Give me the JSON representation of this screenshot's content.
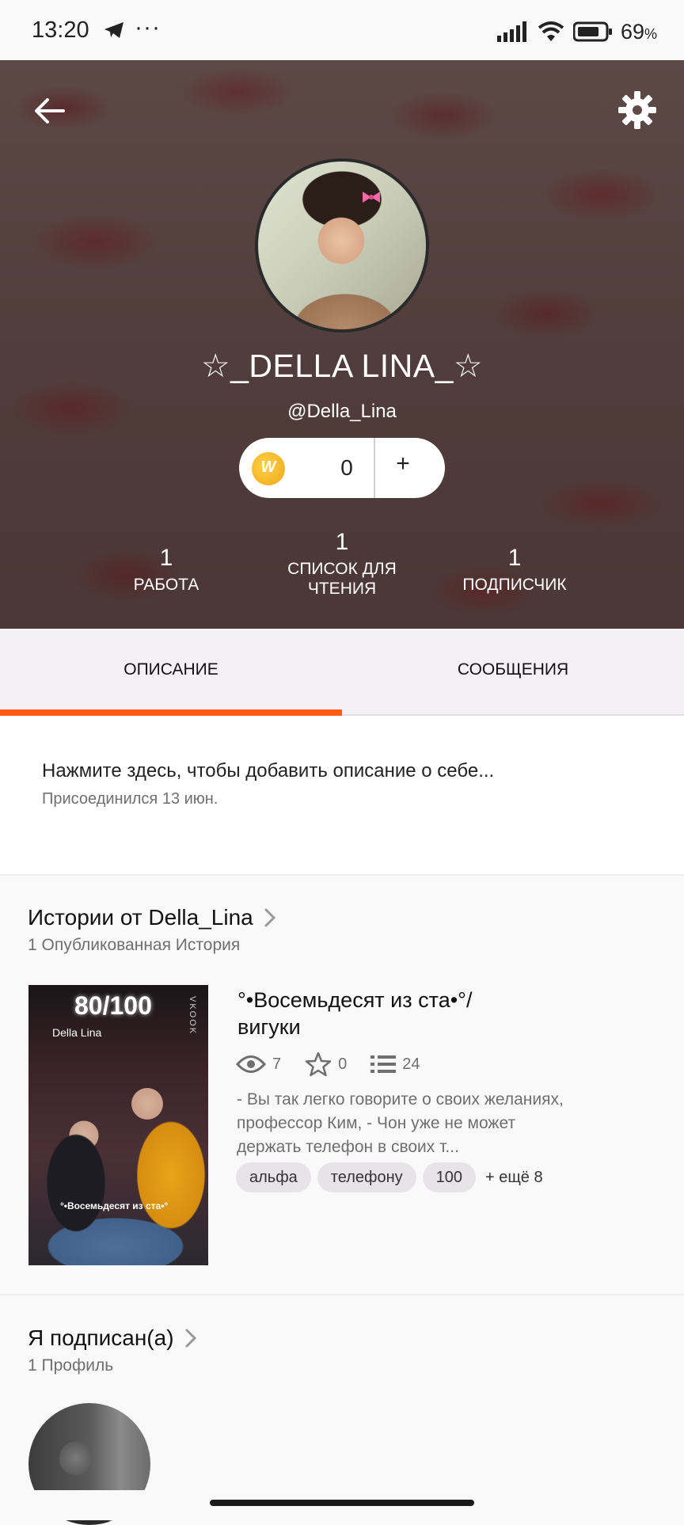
{
  "status_bar": {
    "time": "13:20",
    "dots": "···",
    "battery_percent": "69",
    "battery_suffix": "%"
  },
  "header": {
    "display_name": "☆_DELLA LINA_☆",
    "username": "@Della_Lina",
    "coins": {
      "icon_letter": "W",
      "count": "0",
      "plus": "+"
    },
    "stats": [
      {
        "value": "1",
        "label": "РАБОТА"
      },
      {
        "value": "1",
        "label": "СПИСОК ДЛЯ ЧТЕНИЯ"
      },
      {
        "value": "1",
        "label": "ПОДПИСЧИК"
      }
    ]
  },
  "tabs": [
    {
      "label": "ОПИСАНИЕ",
      "active": true
    },
    {
      "label": "СООБЩЕНИЯ",
      "active": false
    }
  ],
  "about": {
    "placeholder": "Нажмите здесь, чтобы добавить описание о себе...",
    "joined": "Присоединился 13 июн."
  },
  "stories_section": {
    "title": "Истории от Della_Lina",
    "subtitle": "1 Опубликованная История",
    "story": {
      "cover": {
        "title": "80/100",
        "author": "Della Lina",
        "side_text": "VKOOK",
        "subtitle": "°•Восемьдесят из ста•°"
      },
      "title": "°•Восемьдесят из ста•°/ вигуки",
      "reads": "7",
      "votes": "0",
      "parts": "24",
      "description": "- Вы так легко говорите о своих желаниях, профессор Ким, - Чон уже не может держать телефон в своих т...",
      "tags": [
        "альфа",
        "телефону",
        "100"
      ],
      "more_tags": "+ ещё 8"
    }
  },
  "following_section": {
    "title": "Я подписан(а)",
    "subtitle": "1 Профиль"
  },
  "colors": {
    "accent": "#ff5a14",
    "coin": "#f2a515"
  }
}
